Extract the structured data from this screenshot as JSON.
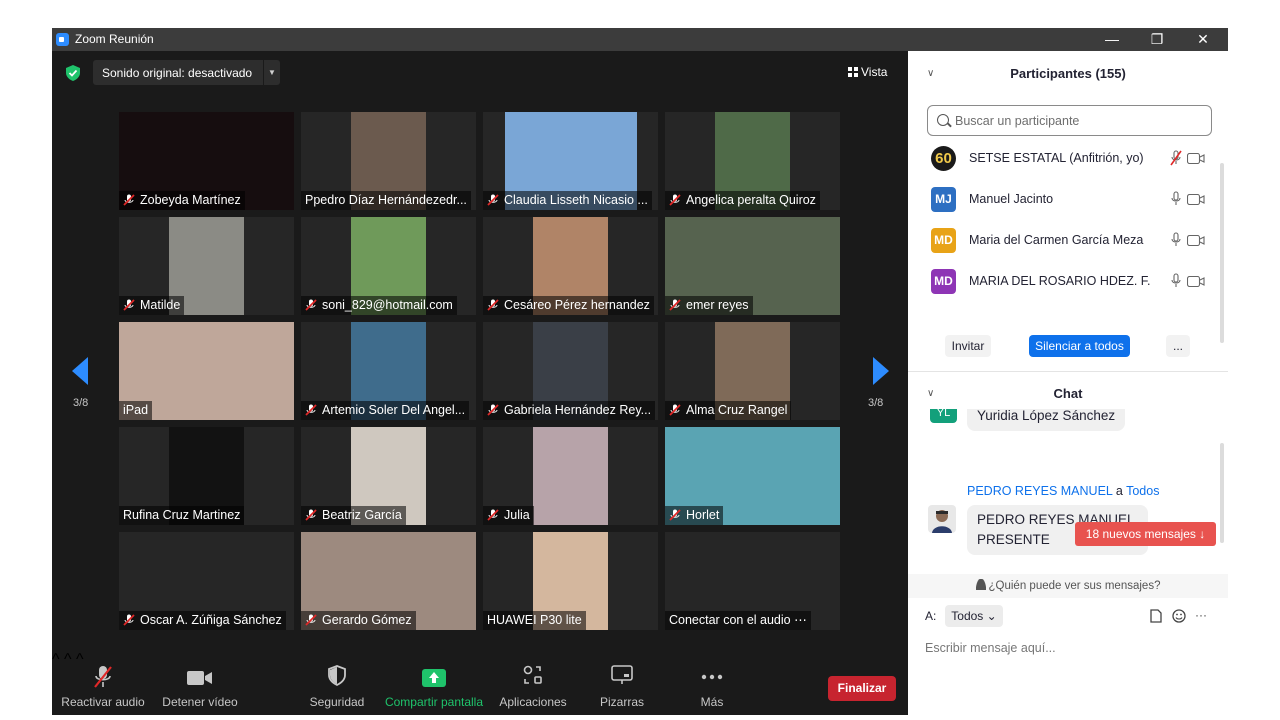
{
  "window": {
    "title": "Zoom Reunión",
    "controls": {
      "minimize": "—",
      "restore": "❐",
      "close": "✕"
    }
  },
  "topbar": {
    "audio_label": "Sonido original: desactivado",
    "view_label": "Vista"
  },
  "pager": {
    "left": "3/8",
    "right": "3/8"
  },
  "tiles": [
    {
      "name": "Zobeyda Martínez",
      "muted": true
    },
    {
      "name": "Ppedro Díaz Hernándezedr...",
      "muted": false
    },
    {
      "name": "Claudia Lisseth Nicasio ...",
      "muted": true
    },
    {
      "name": "Angelica peralta Quiroz",
      "muted": true
    },
    {
      "name": "Matilde",
      "muted": true
    },
    {
      "name": "soni_829@hotmail.com",
      "muted": true
    },
    {
      "name": "Cesáreo Pérez hernandez",
      "muted": true
    },
    {
      "name": "emer reyes",
      "muted": true
    },
    {
      "name": "iPad",
      "muted": false
    },
    {
      "name": "Artemio Soler Del Angel...",
      "muted": true
    },
    {
      "name": "Gabriela Hernández Rey...",
      "muted": true
    },
    {
      "name": "Alma Cruz Rangel",
      "muted": true
    },
    {
      "name": "Rufina Cruz Martinez",
      "muted": false
    },
    {
      "name": "Beatriz García",
      "muted": true
    },
    {
      "name": "Julia",
      "muted": true
    },
    {
      "name": "Horlet",
      "muted": true
    },
    {
      "name": "Oscar A. Zúñiga Sánchez",
      "muted": true
    },
    {
      "name": "Gerardo Gómez",
      "muted": true
    },
    {
      "name": "HUAWEI P30 lite",
      "muted": false
    },
    {
      "name": "Conectar con el audio ⋯",
      "muted": false
    }
  ],
  "toolbar": {
    "audio": "Reactivar audio",
    "video": "Detener vídeo",
    "security": "Seguridad",
    "share": "Compartir pantalla",
    "apps": "Aplicaciones",
    "whiteboards": "Pizarras",
    "more": "Más",
    "end": "Finalizar"
  },
  "participants": {
    "title": "Participantes (155)",
    "search_placeholder": "Buscar un participante",
    "list": [
      {
        "initials": "60",
        "name": "SETSE ESTATAL (Anfitrión, yo)",
        "color": "#1a1a1a"
      },
      {
        "initials": "MJ",
        "name": "Manuel Jacinto",
        "color": "#2d6fc2"
      },
      {
        "initials": "MD",
        "name": "Maria del Carmen García Meza",
        "color": "#e8a317"
      },
      {
        "initials": "MD",
        "name": "MARIA DEL ROSARIO HDEZ. F.",
        "color": "#8e35b5"
      }
    ],
    "invite": "Invitar",
    "mute_all": "Silenciar a todos",
    "more": "..."
  },
  "chat": {
    "title": "Chat",
    "prev_avatar": "YL",
    "prev_message": "Yuridia López Sánchez",
    "sender": "PEDRO REYES MANUEL",
    "to_word": "a",
    "recipient": "Todos",
    "message_line1": "PEDRO REYES MANUEL,",
    "message_line2": "PRESENTE",
    "new_messages": "18 nuevos mensajes ↓",
    "who_sees": "¿Quién puede ver sus mensajes?",
    "to_label": "A:",
    "to_value": "Todos ⌄",
    "input_placeholder": "Escribir mensaje aquí...",
    "tool_more": "···"
  },
  "colors": {
    "accent": "#2d8cff",
    "end": "#c7242f",
    "share": "#1fc36b",
    "muted": "#e02828"
  }
}
